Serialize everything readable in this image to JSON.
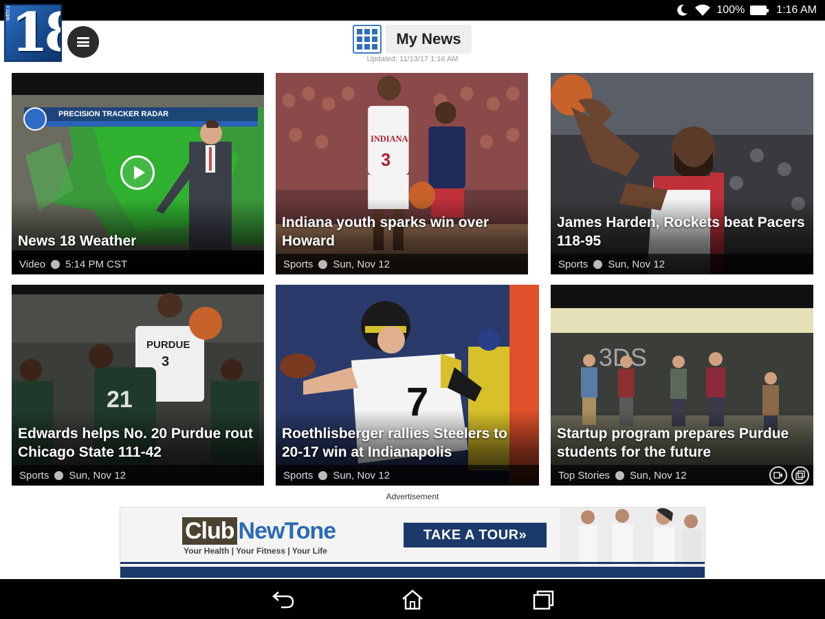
{
  "status_bar": {
    "battery": "100%",
    "time": "1:16 AM",
    "icons": [
      "moon-icon",
      "wifi-icon",
      "battery-icon"
    ]
  },
  "header": {
    "logo_text": "18",
    "logo_side_text": "wthr.com",
    "title": "My News",
    "updated": "Updated: 11/13/17 1:16 AM"
  },
  "tiles": [
    {
      "headline": "News 18 Weather",
      "category": "Video",
      "time": "5:14 PM CST",
      "has_play": true
    },
    {
      "headline": "Indiana youth sparks win over Howard",
      "category": "Sports",
      "time": "Sun, Nov 12"
    },
    {
      "headline": "James Harden, Rockets beat Pacers 118-95",
      "category": "Sports",
      "time": "Sun, Nov 12"
    },
    {
      "headline": "Edwards helps No. 20 Purdue rout Chicago State 111-42",
      "category": "Sports",
      "time": "Sun, Nov 12"
    },
    {
      "headline": "Roethlisberger rallies Steelers to 20-17 win at Indianapolis",
      "category": "Sports",
      "time": "Sun, Nov 12"
    },
    {
      "headline": "Startup program prepares Purdue students for the future",
      "category": "Top Stories",
      "time": "Sun, Nov 12",
      "corner_icons": [
        "video-icon",
        "gallery-icon"
      ]
    }
  ],
  "ad": {
    "label": "Advertisement",
    "brand_club": "Club",
    "brand_newtone": "NewTone",
    "tagline": "Your Health | Your Fitness | Your Life",
    "cta": "TAKE A TOUR»"
  },
  "overlays": {
    "weather_banner": "PRECISION TRACKER RADAR",
    "jersey_indiana": "INDIANA",
    "jersey_purdue": "PURDUE",
    "chalkboard": "3DS"
  },
  "colors": {
    "status_bar": "#000000",
    "nav_bar": "#000000",
    "accent_blue": "#2f6fb8",
    "ad_navy": "#1b3a6b"
  }
}
